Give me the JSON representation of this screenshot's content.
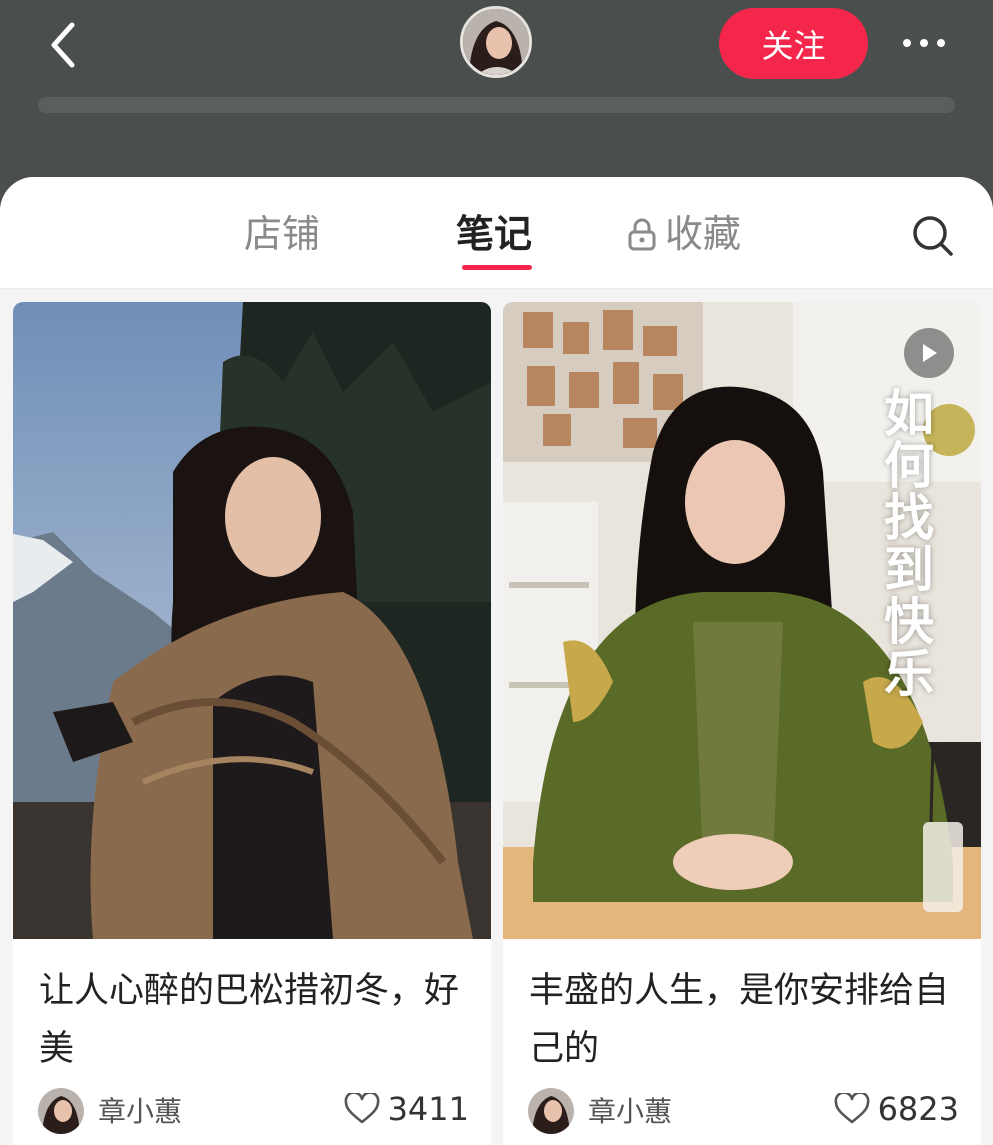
{
  "header": {
    "follow_label": "关注",
    "accent_color": "#f5264b"
  },
  "tabs": [
    {
      "label": "店铺"
    },
    {
      "label": "笔记",
      "active": true
    },
    {
      "label": "收藏",
      "locked": true
    }
  ],
  "notes": [
    {
      "title": "让人心醉的巴松措初冬，好美",
      "author": "章小蕙",
      "likes": "3411",
      "is_video": false
    },
    {
      "title": "丰盛的人生，是你安排给自己的",
      "author": "章小蕙",
      "likes": "6823",
      "is_video": true,
      "overlay_text": "如何找到快乐"
    }
  ],
  "icons": {
    "back": "chevron-left-icon",
    "more": "more-dots-icon",
    "search": "search-icon",
    "lock": "lock-icon",
    "like": "heart-icon",
    "play": "play-icon"
  }
}
